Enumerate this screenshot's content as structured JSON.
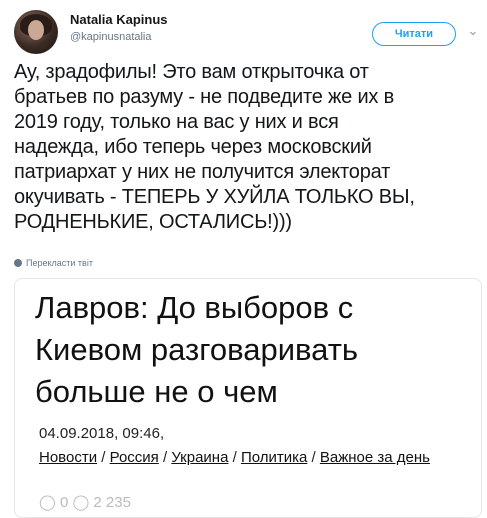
{
  "author": {
    "name": "Natalia Kapinus",
    "handle": "@kapinusnatalia"
  },
  "follow_label": "Читати",
  "chevron_icon": "chevron-down-icon",
  "tweet_text": "Ау, зрадофилы! Это вам открыточка от\nбратьев по разуму - не подведите же их в\n2019 году, только на вас у них и вся\nнадежда, ибо теперь через московский\nпатриархат у них не получится электорат\nокучивать - ТЕПЕРЬ У ХУЙЛА ТОЛЬКО ВЫ,\nРОДНЕНЬКИЕ, ОСТАЛИСЬ!)))",
  "translate_label": "Перекласти твіт",
  "card": {
    "title": "Лавров: До выборов с\nКиевом разговаривать\nбольше не о чем",
    "date": "04.09.2018, 09:46,",
    "categories": [
      "Новости",
      "Россия",
      "Украина",
      "Политика",
      "Важное за день"
    ],
    "separator": " / ",
    "stats": "◯ 0  ◯ 2 235"
  }
}
